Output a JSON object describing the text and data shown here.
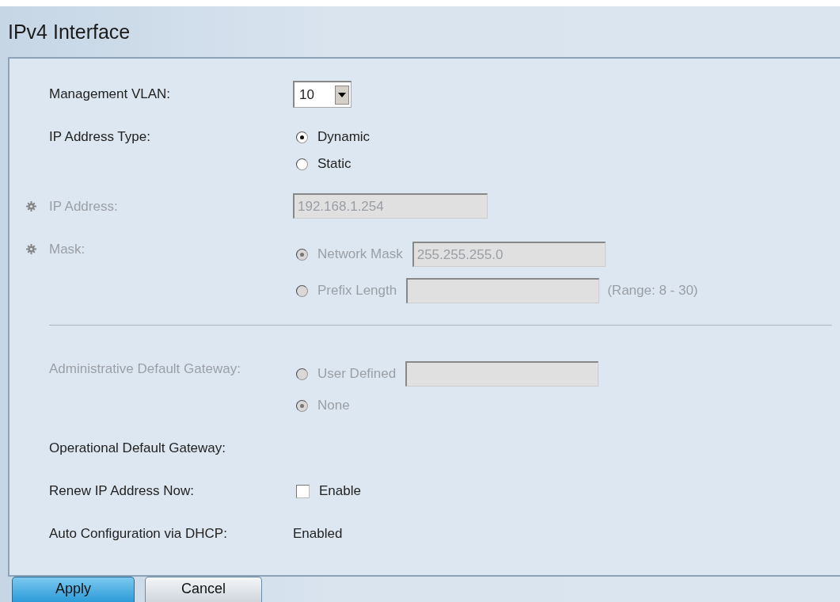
{
  "title": "IPv4 Interface",
  "rows": [
    {
      "kind": "select",
      "label": "Management VLAN:",
      "value": "10",
      "disabled": false,
      "required": false
    },
    {
      "kind": "radios",
      "label": "IP Address Type:",
      "disabled": false,
      "required": false,
      "options": [
        {
          "kind": "plain",
          "label": "Dynamic",
          "selected": true
        },
        {
          "kind": "plain",
          "label": "Static",
          "selected": false
        }
      ]
    },
    {
      "kind": "text",
      "label": "IP Address:",
      "value": "192.168.1.254",
      "disabled": true,
      "required": true
    },
    {
      "kind": "radios",
      "label": "Mask:",
      "disabled": true,
      "required": true,
      "options": [
        {
          "kind": "field",
          "label": "Network Mask",
          "selected": true,
          "value": "255.255.255.0"
        },
        {
          "kind": "field",
          "label": "Prefix Length",
          "selected": false,
          "hint": "(Range: 8 - 30)"
        }
      ]
    },
    {
      "kind": "divider"
    },
    {
      "kind": "radios",
      "label": "Administrative Default Gateway:",
      "disabled": true,
      "required": false,
      "options": [
        {
          "kind": "field",
          "label": "User Defined",
          "selected": false
        },
        {
          "kind": "plain",
          "label": "None",
          "selected": true
        }
      ]
    },
    {
      "kind": "label",
      "label": "Operational Default Gateway:",
      "disabled": false,
      "required": false
    },
    {
      "kind": "checkbox",
      "label": "Renew IP Address Now:",
      "disabled": false,
      "required": false,
      "option": "Enable",
      "checked": false
    },
    {
      "kind": "static",
      "label": "Auto Configuration via DHCP:",
      "value": "Enabled",
      "disabled": false,
      "required": false
    }
  ],
  "buttons": [
    {
      "label": "Apply",
      "primary": true
    },
    {
      "label": "Cancel",
      "primary": false
    }
  ]
}
